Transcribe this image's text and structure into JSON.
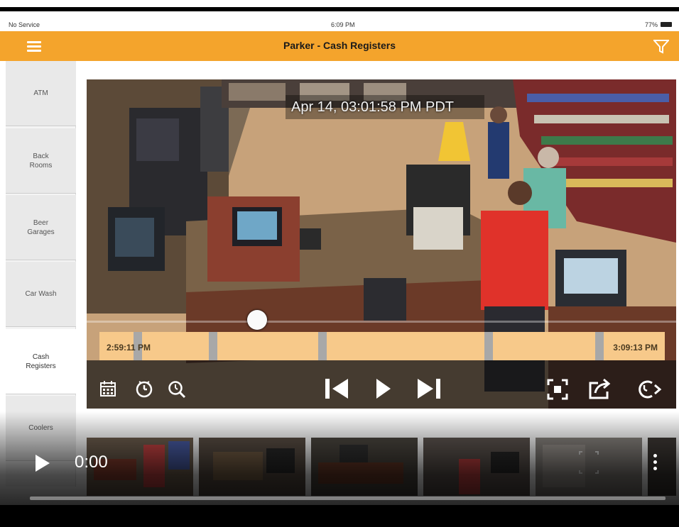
{
  "status_bar": {
    "carrier": "No Service",
    "time": "6:09 PM",
    "battery": "77%"
  },
  "nav": {
    "title": "Parker - Cash Registers"
  },
  "sidebar": {
    "items": [
      {
        "label": "ATM",
        "active": false
      },
      {
        "label": "Back\nRooms",
        "active": false
      },
      {
        "label": "Beer\nGarages",
        "active": false
      },
      {
        "label": "Car Wash",
        "active": false
      },
      {
        "label": "Cash\nRegisters",
        "active": true
      },
      {
        "label": "Coolers",
        "active": false
      }
    ]
  },
  "video": {
    "timestamp": "Apr 14, 03:01:58 PM PDT",
    "scrub_progress": 0.29
  },
  "timeline": {
    "start_label": "2:59:11 PM",
    "end_label": "3:09:13 PM"
  },
  "controls": {
    "icons": [
      "calendar-icon",
      "clock-icon",
      "zoom-icon",
      "skip-back-icon",
      "play-icon",
      "skip-forward-icon",
      "fullscreen-icon",
      "share-icon",
      "cycle-icon"
    ]
  },
  "thumbnails": {
    "count": 6
  },
  "player_overlay": {
    "time": "0:00",
    "progress": 0
  },
  "colors": {
    "accent": "#f4a42c",
    "timeline": "#f7c98a"
  }
}
